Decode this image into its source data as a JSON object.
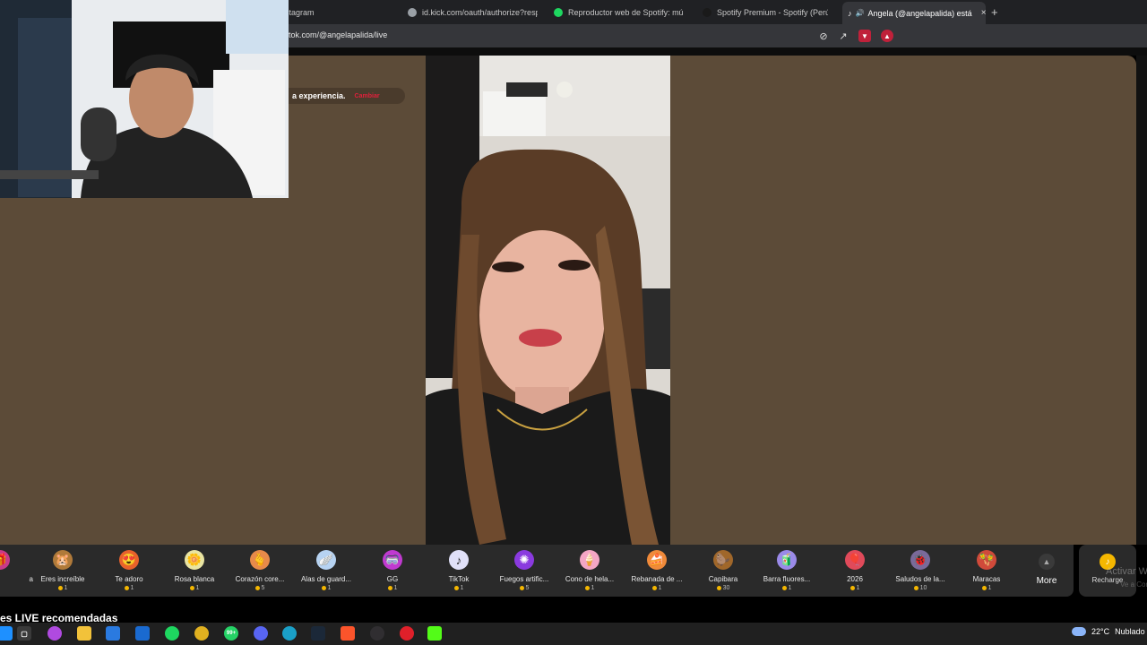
{
  "browser": {
    "tabs": [
      {
        "label": "stagram",
        "active": false,
        "icon_color": "#e1306c"
      },
      {
        "label": "id.kick.com/oauth/authorize?respon",
        "active": false,
        "icon_color": "#9aa0a6"
      },
      {
        "label": "Reproductor web de Spotify: música",
        "active": false,
        "icon_color": "#1ed760"
      },
      {
        "label": "Spotify Premium - Spotify (Perú)",
        "active": false,
        "icon_color": "#1a1a1a"
      },
      {
        "label": "Angela (@angelapalida) está",
        "active": true,
        "icon_color": "#000000"
      }
    ],
    "tab_close": "×",
    "new_tab": "+",
    "url": "tok.com/@angelapalida/live"
  },
  "page": {
    "notice_text": "a experiencia.",
    "notice_link": "Cambiar",
    "gifts": [
      {
        "name": "a",
        "price": "",
        "emoji": "🎁",
        "color": "#c83a8a"
      },
      {
        "name": "Eres increíble",
        "price": "1",
        "emoji": "🐹",
        "color": "#b07a3a"
      },
      {
        "name": "Te adoro",
        "price": "1",
        "emoji": "😍",
        "color": "#e8612c"
      },
      {
        "name": "Rosa blanca",
        "price": "1",
        "emoji": "🌼",
        "color": "#e9e4a2"
      },
      {
        "name": "Corazón core...",
        "price": "5",
        "emoji": "🫰",
        "color": "#e88a4a"
      },
      {
        "name": "Alas de guard...",
        "price": "1",
        "emoji": "🪽",
        "color": "#b7d3f2"
      },
      {
        "name": "GG",
        "price": "1",
        "emoji": "🥽",
        "color": "#c03ad0"
      },
      {
        "name": "TikTok",
        "price": "1",
        "emoji": "♪",
        "color": "#e0e0f8"
      },
      {
        "name": "Fuegos artific...",
        "price": "5",
        "emoji": "✺",
        "color": "#8a3adf"
      },
      {
        "name": "Cono de hela...",
        "price": "1",
        "emoji": "🍦",
        "color": "#f4a6c4"
      },
      {
        "name": "Rebanada de ...",
        "price": "1",
        "emoji": "🍰",
        "color": "#f08a3a"
      },
      {
        "name": "Capibara",
        "price": "30",
        "emoji": "🦫",
        "color": "#a0672a"
      },
      {
        "name": "Barra fluores...",
        "price": "1",
        "emoji": "🧃",
        "color": "#9a8ae8"
      },
      {
        "name": "2026",
        "price": "1",
        "emoji": "🎈",
        "color": "#e04a5a"
      },
      {
        "name": "Saludos de la...",
        "price": "10",
        "emoji": "🐞",
        "color": "#7a6a9a"
      },
      {
        "name": "Maracas",
        "price": "1",
        "emoji": "🪇",
        "color": "#d04a3a"
      }
    ],
    "more_label": "More",
    "recharge_label": "Recharge",
    "section_title": "es LIVE recomendadas",
    "watermark_1": "Activar W",
    "watermark_2": "Ve a Config"
  },
  "taskbar": {
    "apps": [
      {
        "name": "windows-start-icon",
        "glyph": "",
        "color": "#1e90ff"
      },
      {
        "name": "task-view-icon",
        "glyph": "",
        "color": "#3a3a3a"
      },
      {
        "name": "copilot-icon",
        "glyph": "",
        "color": "#b04ae0"
      },
      {
        "name": "file-explorer-icon",
        "glyph": "",
        "color": "#f2c23a"
      },
      {
        "name": "store-icon",
        "glyph": "",
        "color": "#2a7ae0"
      },
      {
        "name": "outlook-icon",
        "glyph": "",
        "color": "#1a6ad0"
      },
      {
        "name": "chrome-icon",
        "glyph": "",
        "color": "#e0b020"
      },
      {
        "name": "spotify-icon",
        "glyph": "",
        "color": "#1ed760"
      },
      {
        "name": "whatsapp-icon",
        "glyph": "99+",
        "color": "#25d366"
      },
      {
        "name": "discord-icon",
        "glyph": "",
        "color": "#5865f2"
      },
      {
        "name": "edge-icon",
        "glyph": "",
        "color": "#1aa0c8"
      },
      {
        "name": "steam-icon",
        "glyph": "",
        "color": "#1b2838"
      },
      {
        "name": "brave-icon",
        "glyph": "",
        "color": "#fb542b"
      },
      {
        "name": "obs-icon",
        "glyph": "",
        "color": "#302e31"
      },
      {
        "name": "opera-icon",
        "glyph": "",
        "color": "#e0202a"
      },
      {
        "name": "kick-app-icon",
        "glyph": "",
        "color": "#53fc18"
      }
    ],
    "temperature": "22°C",
    "condition": "Nublado"
  }
}
